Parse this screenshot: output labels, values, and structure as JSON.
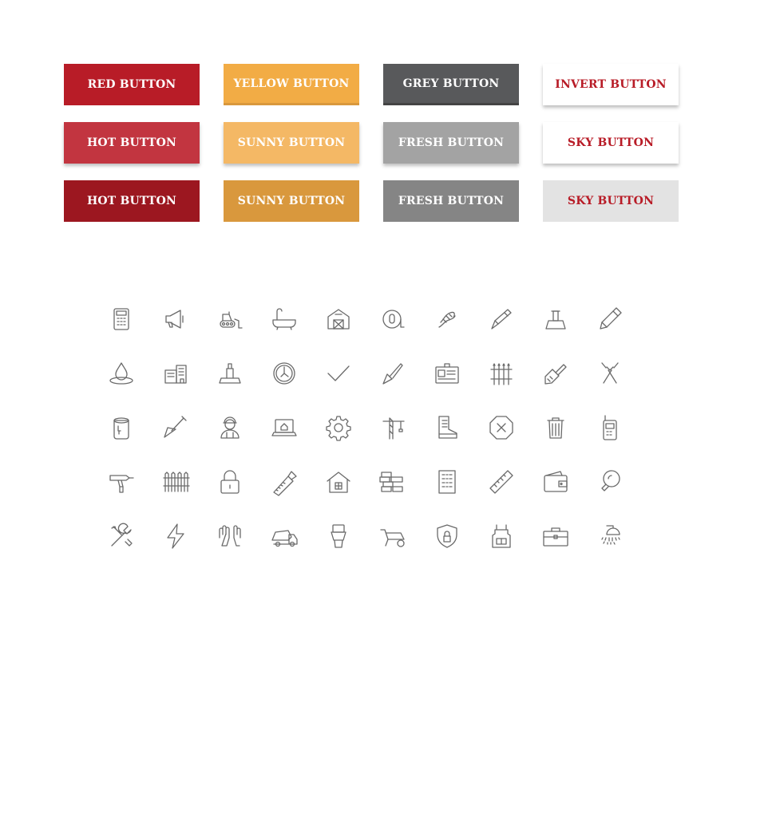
{
  "buttons": {
    "row1": {
      "red": "RED BUTTON",
      "yellow": "YELLOW BUTTON",
      "grey": "GREY BUTTON",
      "invert": "INVERT BUTTON"
    },
    "row2": {
      "hot": "HOT BUTTON",
      "sunny": "SUNNY BUTTON",
      "fresh": "FRESH BUTTON",
      "sky": "SKY BUTTON"
    },
    "row3": {
      "hot": "HOT BUTTON",
      "sunny": "SUNNY BUTTON",
      "fresh": "FRESH BUTTON",
      "sky": "SKY BUTTON"
    }
  },
  "colors": {
    "red": "#b81c27",
    "red_hot": "#c23540",
    "red_active": "#9c1720",
    "yellow": "#f2ac45",
    "yellow_sunny": "#f4b865",
    "yellow_active": "#d9983d",
    "grey": "#58595b",
    "grey_fresh": "#a3a3a3",
    "grey_active": "#858585",
    "invert_text": "#b81c27",
    "sky_active_bg": "#e3e3e3",
    "icon_stroke": "#6a6a6a"
  },
  "icons": [
    [
      "calculator-icon",
      "megaphone-icon",
      "bulldozer-icon",
      "bathtub-icon",
      "barn-icon",
      "tape-measure-icon",
      "rope-icon",
      "utility-knife-icon",
      "putty-knife-icon",
      "pencil-icon"
    ],
    [
      "water-drop-icon",
      "buildings-icon",
      "scraper-icon",
      "clock-icon",
      "checkmark-icon",
      "spatula-icon",
      "id-card-icon",
      "fence-spikes-icon",
      "paintbrush-icon",
      "pliers-icon"
    ],
    [
      "paint-bucket-icon",
      "trowel-icon",
      "worker-icon",
      "laptop-home-icon",
      "gear-icon",
      "crane-icon",
      "boot-icon",
      "stop-sign-icon",
      "trash-can-icon",
      "walkie-talkie-icon"
    ],
    [
      "drill-icon",
      "fence-icon",
      "padlock-icon",
      "saw-icon",
      "house-icon",
      "bricks-icon",
      "building-icon",
      "ruler-icon",
      "wallet-icon",
      "light-bulb-icon"
    ],
    [
      "tools-icon",
      "lightning-icon",
      "gloves-icon",
      "cement-truck-icon",
      "toilet-icon",
      "wheelbarrow-icon",
      "shield-lock-icon",
      "apron-icon",
      "toolbox-icon",
      "shower-icon"
    ]
  ]
}
